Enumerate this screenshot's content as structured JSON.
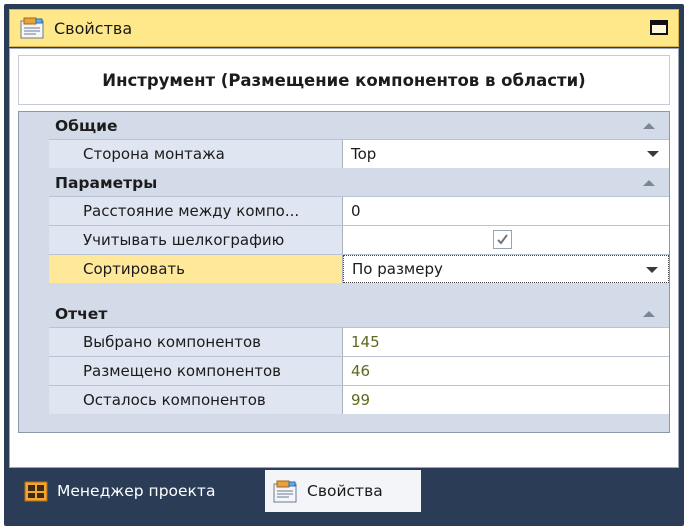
{
  "window": {
    "title": "Свойства",
    "title_icon": "properties-icon"
  },
  "panel": {
    "heading": "Инструмент (Размещение компонентов в области)"
  },
  "categories": [
    {
      "label": "Общие",
      "rows": [
        {
          "name": "Сторона монтажа",
          "value": "Top",
          "type": "dropdown"
        }
      ]
    },
    {
      "label": "Параметры",
      "rows": [
        {
          "name": "Расстояние между компо...",
          "value": "0",
          "type": "text"
        },
        {
          "name": "Учитывать шелкографию",
          "value": "",
          "checked": true,
          "type": "checkbox"
        },
        {
          "name": "Сортировать",
          "value": "По размеру",
          "type": "dropdown",
          "selected": true
        }
      ]
    },
    {
      "label": "Отчет",
      "rows": [
        {
          "name": "Выбрано компонентов",
          "value": "145",
          "type": "readonly"
        },
        {
          "name": "Размещено компонентов",
          "value": "46",
          "type": "readonly"
        },
        {
          "name": "Осталось компонентов",
          "value": "99",
          "type": "readonly"
        }
      ]
    }
  ],
  "tabs": [
    {
      "label": "Менеджер проекта",
      "icon": "project-manager-icon",
      "active": false
    },
    {
      "label": "Свойства",
      "icon": "properties-icon",
      "active": true
    }
  ],
  "colors": {
    "title_bar": "#ffe88a",
    "frame": "#2b3c57",
    "category_bg": "#d3dbe8",
    "selected_row": "#ffe89a",
    "readonly_value": "#5c6a1e"
  }
}
